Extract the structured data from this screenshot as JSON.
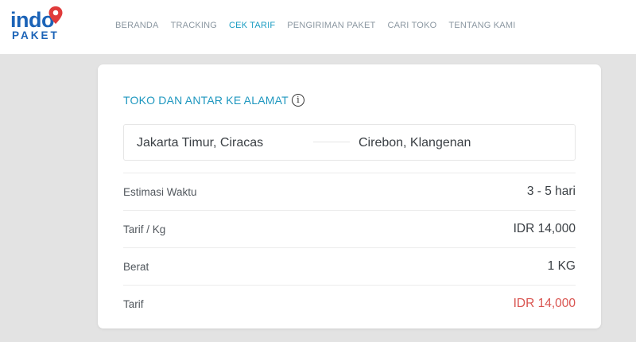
{
  "brand": {
    "logo_top": "indo",
    "logo_bottom": "PAKET",
    "pin_color": "#e03b3b",
    "logo_color": "#1b63b7"
  },
  "nav": {
    "items": [
      {
        "label": "BERANDA",
        "active": false
      },
      {
        "label": "TRACKING",
        "active": false
      },
      {
        "label": "CEK TARIF",
        "active": true
      },
      {
        "label": "PENGIRIMAN PAKET",
        "active": false
      },
      {
        "label": "CARI TOKO",
        "active": false
      },
      {
        "label": "TENTANG KAMI",
        "active": false
      }
    ],
    "active_color": "#1a9cc2"
  },
  "card": {
    "title": "TOKO DAN ANTAR KE ALAMAT",
    "info_icon": "info-icon",
    "route": {
      "origin": "Jakarta Timur, Ciracas",
      "destination": "Cirebon, Klangenan"
    },
    "rows": [
      {
        "label": "Estimasi Waktu",
        "value": "3 - 5 hari"
      },
      {
        "label": "Tarif / Kg",
        "value": "IDR 14,000"
      },
      {
        "label": "Berat",
        "value": "1 KG"
      },
      {
        "label": "Tarif",
        "value": "IDR 14,000"
      }
    ],
    "total_color": "#d9534f"
  }
}
